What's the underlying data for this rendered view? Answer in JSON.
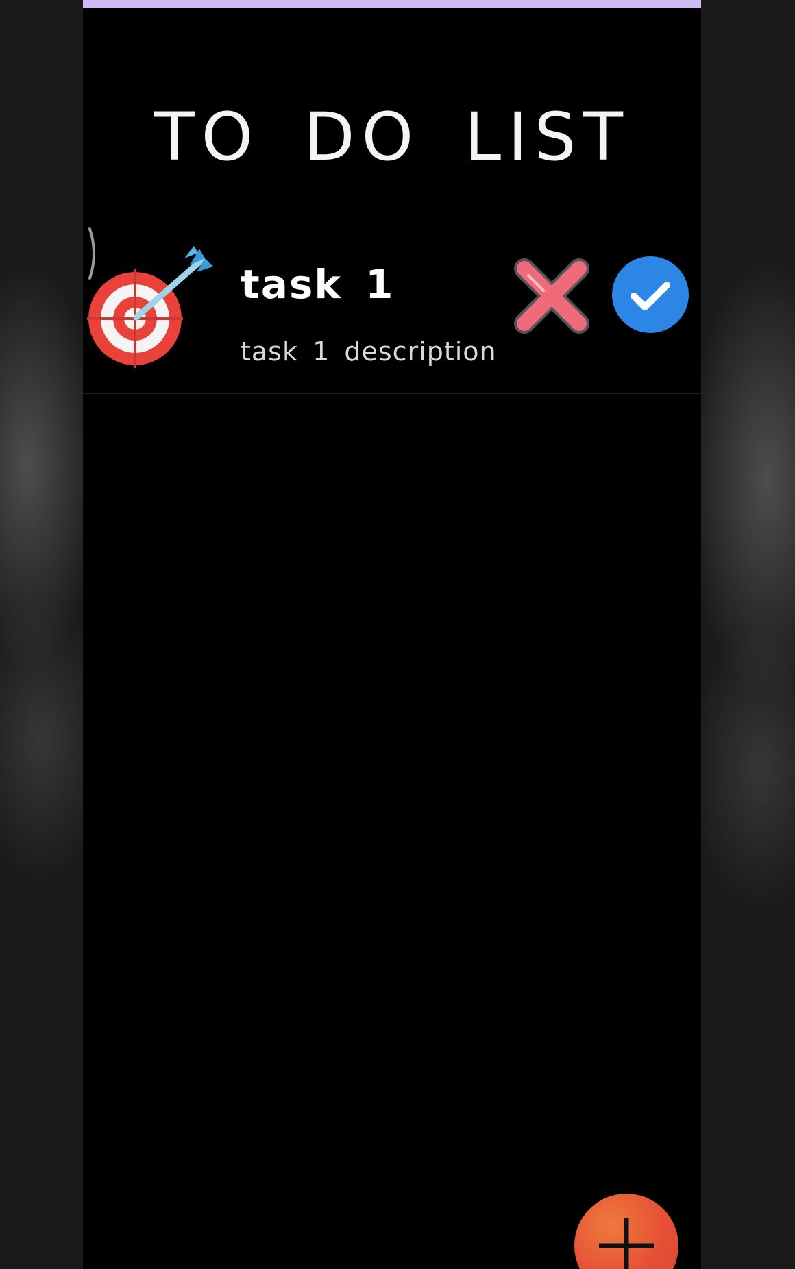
{
  "app": {
    "title": "TO DO LIST"
  },
  "tasks": [
    {
      "title": "task 1",
      "description": "task 1 description",
      "icon": "target-dart-icon",
      "actions": {
        "delete_icon": "close-x-icon",
        "complete_icon": "checkmark-circle-icon"
      }
    }
  ],
  "fab": {
    "icon": "plus-icon"
  },
  "colors": {
    "background": "#000000",
    "status_strip": "#cdbcf5",
    "delete_red": "#f06b7a",
    "complete_blue": "#2b86e6",
    "fab_orange": "#e6573a",
    "target_red": "#e8423a"
  }
}
